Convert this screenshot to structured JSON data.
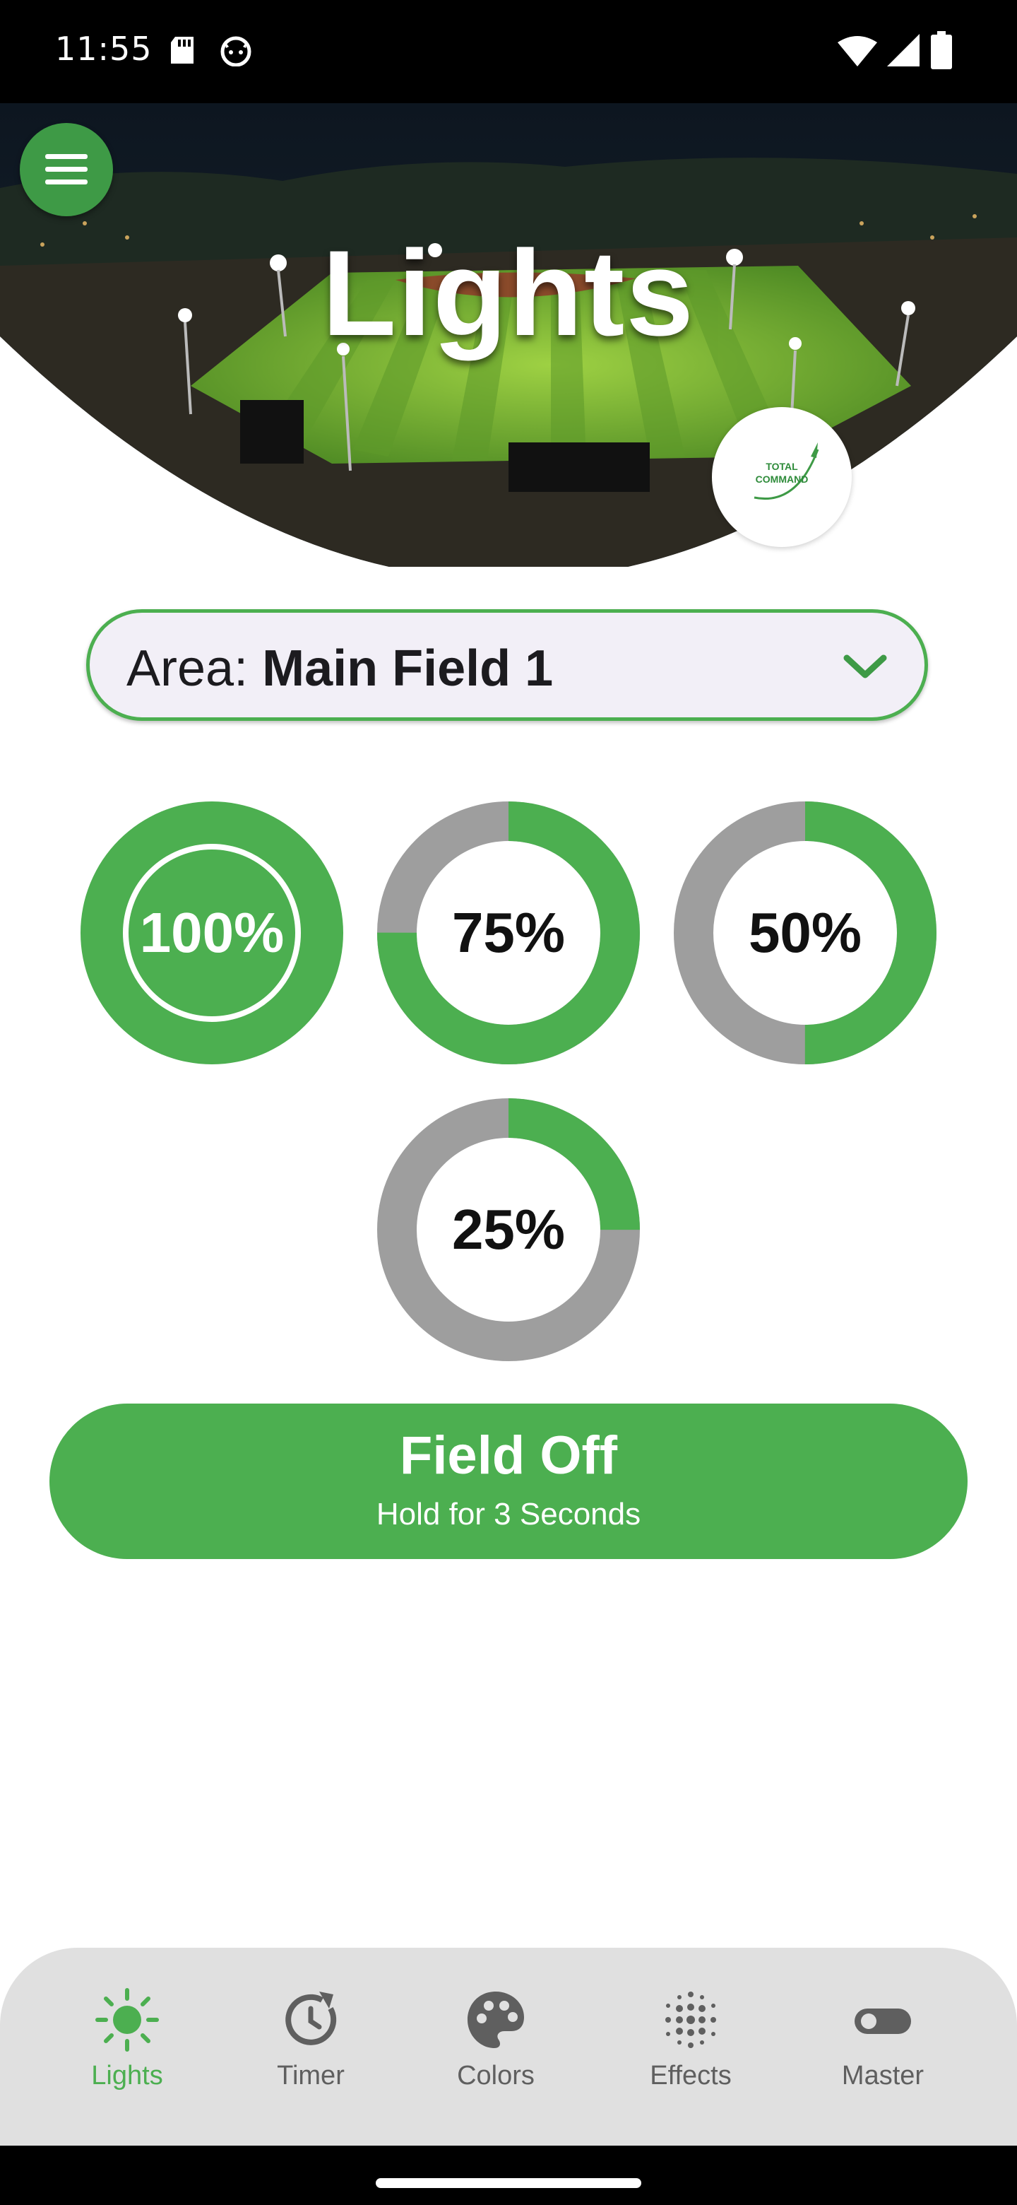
{
  "status_bar": {
    "time": "11:55"
  },
  "hero": {
    "title": "Lights",
    "logo_line1": "TOTAL",
    "logo_line2": "COMMAND"
  },
  "area": {
    "prefix": "Area: ",
    "value": "Main Field 1"
  },
  "levels": [
    {
      "label": "100%",
      "fraction": 1.0,
      "selected": true
    },
    {
      "label": "75%",
      "fraction": 0.75,
      "selected": false
    },
    {
      "label": "50%",
      "fraction": 0.5,
      "selected": false
    },
    {
      "label": "25%",
      "fraction": 0.25,
      "selected": false
    }
  ],
  "field_off": {
    "label": "Field Off",
    "hint": "Hold for 3 Seconds"
  },
  "nav": [
    {
      "label": "Lights",
      "icon": "sun-icon",
      "selected": true
    },
    {
      "label": "Timer",
      "icon": "timer-icon",
      "selected": false
    },
    {
      "label": "Colors",
      "icon": "palette-icon",
      "selected": false
    },
    {
      "label": "Effects",
      "icon": "dots-grid-icon",
      "selected": false
    },
    {
      "label": "Master",
      "icon": "toggle-icon",
      "selected": false
    }
  ],
  "colors": {
    "accent": "#4caf50",
    "ring_track": "#9e9e9e",
    "nav_bg": "#e0e0e0"
  }
}
